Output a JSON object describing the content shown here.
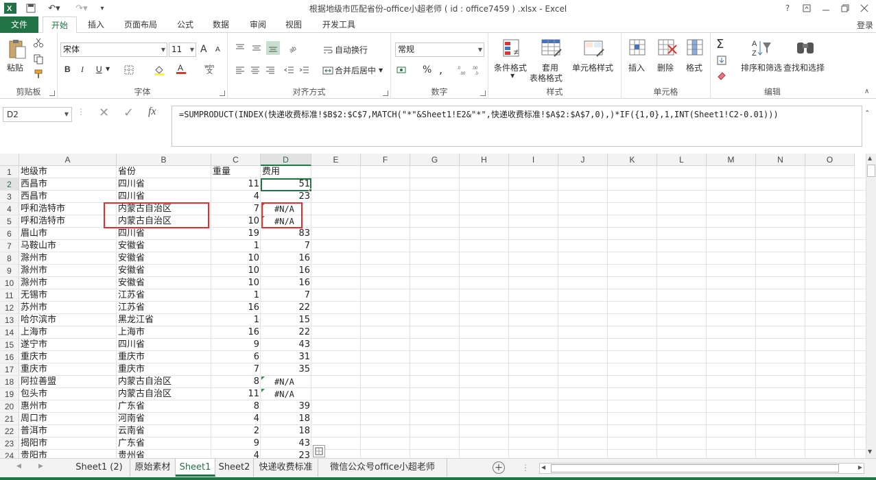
{
  "window": {
    "title": "根据地级市匹配省份-office小超老师 ( id : office7459 ) .xlsx - Excel",
    "help": "?",
    "login": "登录"
  },
  "ribbon_tabs": [
    "文件",
    "开始",
    "插入",
    "页面布局",
    "公式",
    "数据",
    "审阅",
    "视图",
    "开发工具"
  ],
  "ribbon": {
    "clipboard": {
      "label": "剪贴板",
      "paste": "粘贴"
    },
    "font": {
      "label": "字体",
      "name": "宋体",
      "size": "11",
      "bold": "B",
      "italic": "I",
      "underline": "U",
      "grow": "A",
      "shrink": "A"
    },
    "alignment": {
      "label": "对齐方式",
      "wrap": "自动换行",
      "merge": "合并后居中"
    },
    "number": {
      "label": "数字",
      "format": "常规",
      "percent": "%",
      "comma": ","
    },
    "styles": {
      "label": "样式",
      "conditional": "条件格式",
      "table_format_1": "套用",
      "table_format_2": "表格格式",
      "cell_styles": "单元格样式"
    },
    "cells": {
      "label": "单元格",
      "insert": "插入",
      "delete": "删除",
      "format": "格式"
    },
    "editing": {
      "label": "编辑",
      "sort": "排序和筛选",
      "find": "查找和选择"
    }
  },
  "formula_bar": {
    "name_box": "D2",
    "fx": "fx",
    "formula": "=SUMPRODUCT(INDEX(快递收费标准!$B$2:$C$7,MATCH(\"*\"&Sheet1!E2&\"*\",快递收费标准!$A$2:$A$7,0),)*IF({1,0},1,INT(Sheet1!C2-0.01)))"
  },
  "columns": [
    "A",
    "B",
    "C",
    "D",
    "E",
    "F",
    "G",
    "H",
    "I",
    "J",
    "K",
    "L",
    "M",
    "N",
    "O"
  ],
  "rows": [
    {
      "n": "1",
      "a": "地级市",
      "b": "省份",
      "c": "重量",
      "d": "费用"
    },
    {
      "n": "2",
      "a": "西昌市",
      "b": "四川省",
      "c": "11",
      "d": "51"
    },
    {
      "n": "3",
      "a": "西昌市",
      "b": "四川省",
      "c": "4",
      "d": "23"
    },
    {
      "n": "4",
      "a": "呼和浩特市",
      "b": "内蒙古自治区",
      "c": "7",
      "d": "#N/A"
    },
    {
      "n": "5",
      "a": "呼和浩特市",
      "b": "内蒙古自治区",
      "c": "10",
      "d": "#N/A"
    },
    {
      "n": "6",
      "a": "眉山市",
      "b": "四川省",
      "c": "19",
      "d": "83"
    },
    {
      "n": "7",
      "a": "马鞍山市",
      "b": "安徽省",
      "c": "1",
      "d": "7"
    },
    {
      "n": "8",
      "a": "滁州市",
      "b": "安徽省",
      "c": "10",
      "d": "16"
    },
    {
      "n": "9",
      "a": "滁州市",
      "b": "安徽省",
      "c": "10",
      "d": "16"
    },
    {
      "n": "10",
      "a": "滁州市",
      "b": "安徽省",
      "c": "10",
      "d": "16"
    },
    {
      "n": "11",
      "a": "无锡市",
      "b": "江苏省",
      "c": "1",
      "d": "7"
    },
    {
      "n": "12",
      "a": "苏州市",
      "b": "江苏省",
      "c": "16",
      "d": "22"
    },
    {
      "n": "13",
      "a": "哈尔滨市",
      "b": "黑龙江省",
      "c": "1",
      "d": "15"
    },
    {
      "n": "14",
      "a": "上海市",
      "b": "上海市",
      "c": "16",
      "d": "22"
    },
    {
      "n": "15",
      "a": "遂宁市",
      "b": "四川省",
      "c": "9",
      "d": "43"
    },
    {
      "n": "16",
      "a": "重庆市",
      "b": "重庆市",
      "c": "6",
      "d": "31"
    },
    {
      "n": "17",
      "a": "重庆市",
      "b": "重庆市",
      "c": "7",
      "d": "35"
    },
    {
      "n": "18",
      "a": "阿拉善盟",
      "b": "内蒙古自治区",
      "c": "8",
      "d": "#N/A"
    },
    {
      "n": "19",
      "a": "包头市",
      "b": "内蒙古自治区",
      "c": "11",
      "d": "#N/A"
    },
    {
      "n": "20",
      "a": "惠州市",
      "b": "广东省",
      "c": "8",
      "d": "39"
    },
    {
      "n": "21",
      "a": "周口市",
      "b": "河南省",
      "c": "4",
      "d": "18"
    },
    {
      "n": "22",
      "a": "普洱市",
      "b": "云南省",
      "c": "2",
      "d": "18"
    },
    {
      "n": "23",
      "a": "揭阳市",
      "b": "广东省",
      "c": "9",
      "d": "43"
    },
    {
      "n": "24",
      "a": "贵阳市",
      "b": "贵州省",
      "c": "4",
      "d": "23"
    }
  ],
  "sheet_tabs": [
    "Sheet1 (2)",
    "原始素材",
    "Sheet1",
    "Sheet2",
    "快递收费标准",
    "微信公众号office小超老师"
  ],
  "active_sheet": "Sheet1",
  "colors": {
    "accent": "#217346",
    "highlight": "#e03030"
  }
}
